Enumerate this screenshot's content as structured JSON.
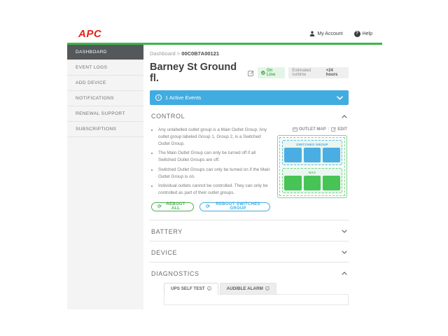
{
  "colors": {
    "brand_red": "#E2231A",
    "brand_green": "#3DB54A",
    "banner_blue": "#41ACE0",
    "outlet_blue": "#4BAEE3",
    "outlet_green": "#47C455",
    "status_green": "#4CAF50"
  },
  "topbar": {
    "logo": "APC",
    "my_account": "My Account",
    "help": "Help",
    "help_glyph": "?"
  },
  "sidebar": {
    "items": [
      {
        "label": "DASHBOARD",
        "active": true
      },
      {
        "label": "EVENT LOGS",
        "active": false
      },
      {
        "label": "ADD DEVICE",
        "active": false
      },
      {
        "label": "NOTIFICATIONS",
        "active": false
      },
      {
        "label": "RENEWAL SUPPORT",
        "active": false
      },
      {
        "label": "SUBSCRIPTIONS",
        "active": false
      }
    ]
  },
  "breadcrumb": {
    "parent": "Dashboard",
    "separator": ">",
    "current": "00C0B7A00121"
  },
  "device_header": {
    "title": "Barney St Ground fl.",
    "status": "On Line",
    "runtime_label": "Estimated runtime",
    "runtime_value": "+24 hours"
  },
  "events_banner": {
    "label": "1 Active Events",
    "info_glyph": "i"
  },
  "control": {
    "title": "CONTROL",
    "outlet_map_link": "OUTLET MAP",
    "edit_link": "EDIT",
    "link_separator": "|",
    "bullets": [
      "Any unlabelled outlet group is a Main Outlet Group. Any outlet group labeled Group 1, Group 2, is a Switched Outlet Group.",
      "The Main Outlet Group can only be turned off if all Switched Outlet Groups are off.",
      "Switched Outlet Groups can only be turned on if the Main Outlet Group is on.",
      "Individual outlets cannot be controlled. They can only be controlled as part of their outlet groups."
    ],
    "buttons": [
      {
        "label": "REBOOT ALL",
        "refresh_glyph": "⟳"
      },
      {
        "label": "REBOOT SWITCHES GROUP",
        "refresh_glyph": "⟳"
      }
    ],
    "outlet_map": {
      "groups": [
        {
          "name": "SWITCHES GROUP",
          "outlet_count": 3
        },
        {
          "name": "NAS",
          "outlet_count": 3
        }
      ]
    }
  },
  "sections": {
    "battery": {
      "title": "BATTERY",
      "expanded": false
    },
    "device": {
      "title": "DEVICE",
      "expanded": false
    },
    "diagnostics": {
      "title": "DIAGNOSTICS",
      "expanded": true
    }
  },
  "diagnostics": {
    "tabs": [
      {
        "label": "UPS SELF TEST",
        "active": true,
        "info_glyph": "i"
      },
      {
        "label": "AUDIBLE ALARM",
        "active": false,
        "info_glyph": "i"
      }
    ]
  }
}
